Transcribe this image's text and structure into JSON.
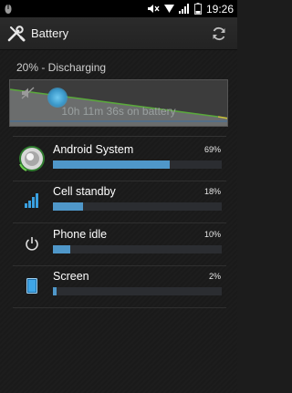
{
  "status_bar": {
    "time": "19:26",
    "icons": [
      "usb-debug-icon",
      "mute-icon",
      "wifi-icon",
      "signal-icon",
      "battery-icon"
    ]
  },
  "action_bar": {
    "title": "Battery",
    "icon": "wrench-screwdriver-icon",
    "action_icon": "refresh-icon"
  },
  "battery": {
    "status": "20% - Discharging",
    "time_on_battery": "10h 11m 36s on battery"
  },
  "usage": [
    {
      "label": "Android System",
      "percent": "69%",
      "fraction": 0.69,
      "icon": "android-system-icon"
    },
    {
      "label": "Cell standby",
      "percent": "18%",
      "fraction": 0.18,
      "icon": "cell-signal-icon"
    },
    {
      "label": "Phone idle",
      "percent": "10%",
      "fraction": 0.1,
      "icon": "power-icon"
    },
    {
      "label": "Screen",
      "percent": "2%",
      "fraction": 0.02,
      "icon": "screen-icon"
    }
  ],
  "colors": {
    "bar_fill": "#4f97c9",
    "graph_line": "#5aa83c"
  }
}
